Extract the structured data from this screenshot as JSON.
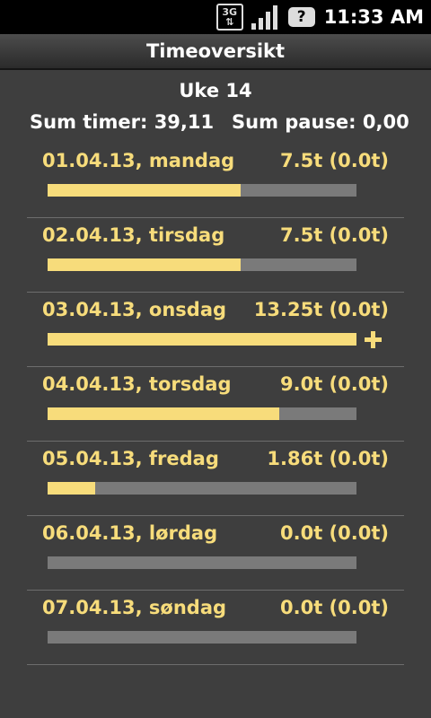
{
  "statusbar": {
    "network": "3G",
    "notification_icon": "?",
    "time": "11:33 AM"
  },
  "title": "Timeoversikt",
  "week_label": "Uke 14",
  "summary": {
    "hours_text": "Sum timer: 39,11",
    "pause_text": "Sum pause: 0,00"
  },
  "colors": {
    "accent": "#f7dc7b",
    "track": "#7a7a7a",
    "background": "#3e3e3e"
  },
  "days": [
    {
      "date": "01.04.13, mandag",
      "hours": "7.5t (0.0t)",
      "fill": 0.625,
      "overflow": false
    },
    {
      "date": "02.04.13, tirsdag",
      "hours": "7.5t (0.0t)",
      "fill": 0.625,
      "overflow": false
    },
    {
      "date": "03.04.13, onsdag",
      "hours": "13.25t (0.0t)",
      "fill": 1.0,
      "overflow": true
    },
    {
      "date": "04.04.13, torsdag",
      "hours": "9.0t (0.0t)",
      "fill": 0.75,
      "overflow": false
    },
    {
      "date": "05.04.13, fredag",
      "hours": "1.86t (0.0t)",
      "fill": 0.155,
      "overflow": false
    },
    {
      "date": "06.04.13, lørdag",
      "hours": "0.0t (0.0t)",
      "fill": 0.0,
      "overflow": false
    },
    {
      "date": "07.04.13, søndag",
      "hours": "0.0t (0.0t)",
      "fill": 0.0,
      "overflow": false
    }
  ]
}
